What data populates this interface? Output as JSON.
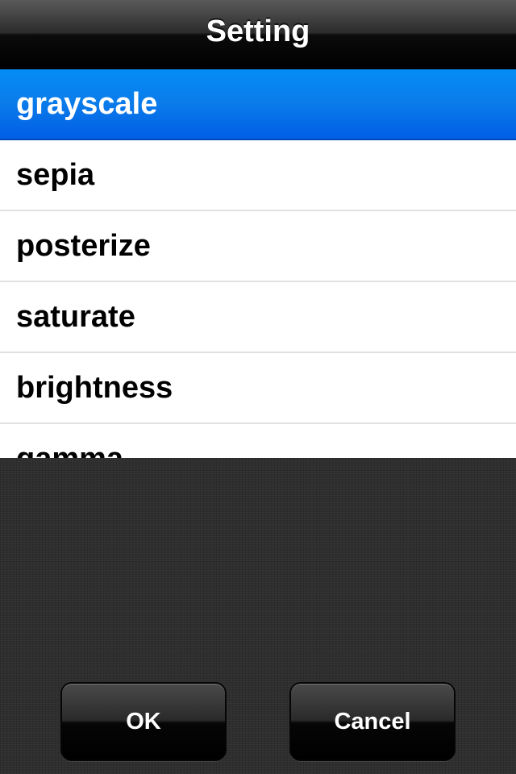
{
  "navbar": {
    "title": "Setting"
  },
  "list": {
    "items": [
      {
        "label": "grayscale",
        "selected": true
      },
      {
        "label": "sepia",
        "selected": false
      },
      {
        "label": "posterize",
        "selected": false
      },
      {
        "label": "saturate",
        "selected": false
      },
      {
        "label": "brightness",
        "selected": false
      },
      {
        "label": "gamma",
        "selected": false
      }
    ]
  },
  "buttons": {
    "ok_label": "OK",
    "cancel_label": "Cancel"
  },
  "colors": {
    "selection_blue": "#0a7bea",
    "navbar_black": "#000000",
    "panel_dark": "#2e2e2e"
  }
}
